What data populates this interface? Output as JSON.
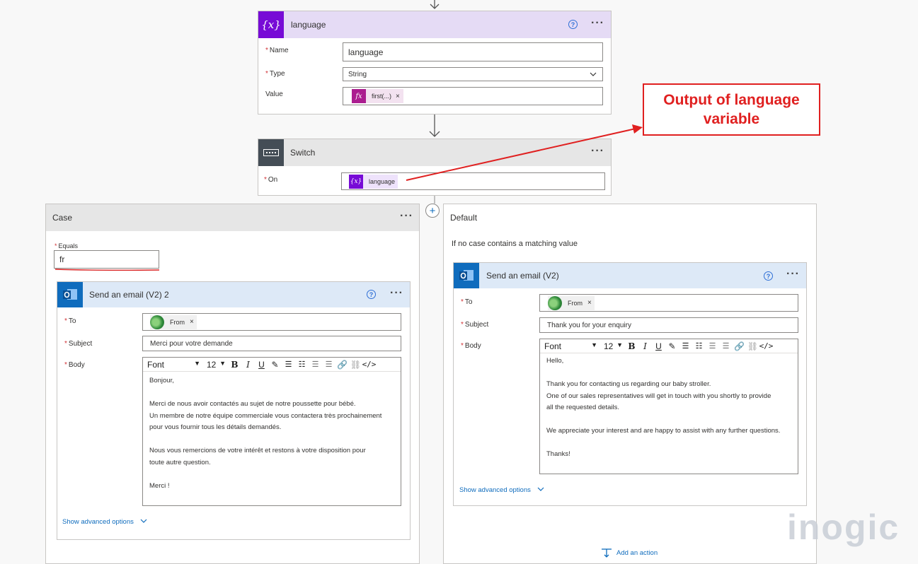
{
  "variable_card": {
    "title": "language",
    "name_label": "Name",
    "name_value": "language",
    "type_label": "Type",
    "type_value": "String",
    "value_label": "Value",
    "value_token": "first(...)",
    "header_color": "#e5dbf5",
    "icon_color": "#770bd6"
  },
  "switch_card": {
    "title": "Switch",
    "on_label": "On",
    "on_token": "language"
  },
  "callout": {
    "text_line1": "Output of language",
    "text_line2": "variable",
    "color": "#e02020"
  },
  "case_card": {
    "title": "Case",
    "equals_label": "Equals",
    "equals_value": "fr",
    "email": {
      "title": "Send an email (V2) 2",
      "to_label": "To",
      "to_token": "From",
      "subject_label": "Subject",
      "subject_value": "Merci pour votre demande",
      "body_label": "Body",
      "toolbar_font": "Font",
      "toolbar_size": "12",
      "body_lines": [
        "Bonjour,",
        "",
        "Merci de nous avoir contactés au sujet de notre poussette pour bébé.",
        "Un membre de notre équipe commerciale vous contactera très prochainement",
        "pour vous fournir tous les détails demandés.",
        "",
        "Nous vous remercions de votre intérêt et restons à votre disposition pour",
        "toute autre question.",
        "",
        "Merci !"
      ],
      "advanced": "Show advanced options"
    }
  },
  "default_card": {
    "title": "Default",
    "description": "If no case contains a matching value",
    "email": {
      "title": "Send an email (V2)",
      "to_label": "To",
      "to_token": "From",
      "subject_label": "Subject",
      "subject_value": "Thank you for your enquiry",
      "body_label": "Body",
      "toolbar_font": "Font",
      "toolbar_size": "12",
      "body_lines": [
        "Hello,",
        "",
        "Thank you for contacting us regarding our baby stroller.",
        "One of our sales representatives will get in touch with you shortly to provide",
        "all the requested details.",
        "",
        "We appreciate your interest and are happy to assist with any further questions.",
        "",
        "Thanks!"
      ],
      "advanced": "Show advanced options"
    },
    "add_action": "Add an action"
  },
  "watermark": "inogic",
  "colors": {
    "outlook_blue": "#0f6cbd",
    "email_header": "#dde9f7",
    "link": "#0f6cbd",
    "required": "#d13438"
  }
}
